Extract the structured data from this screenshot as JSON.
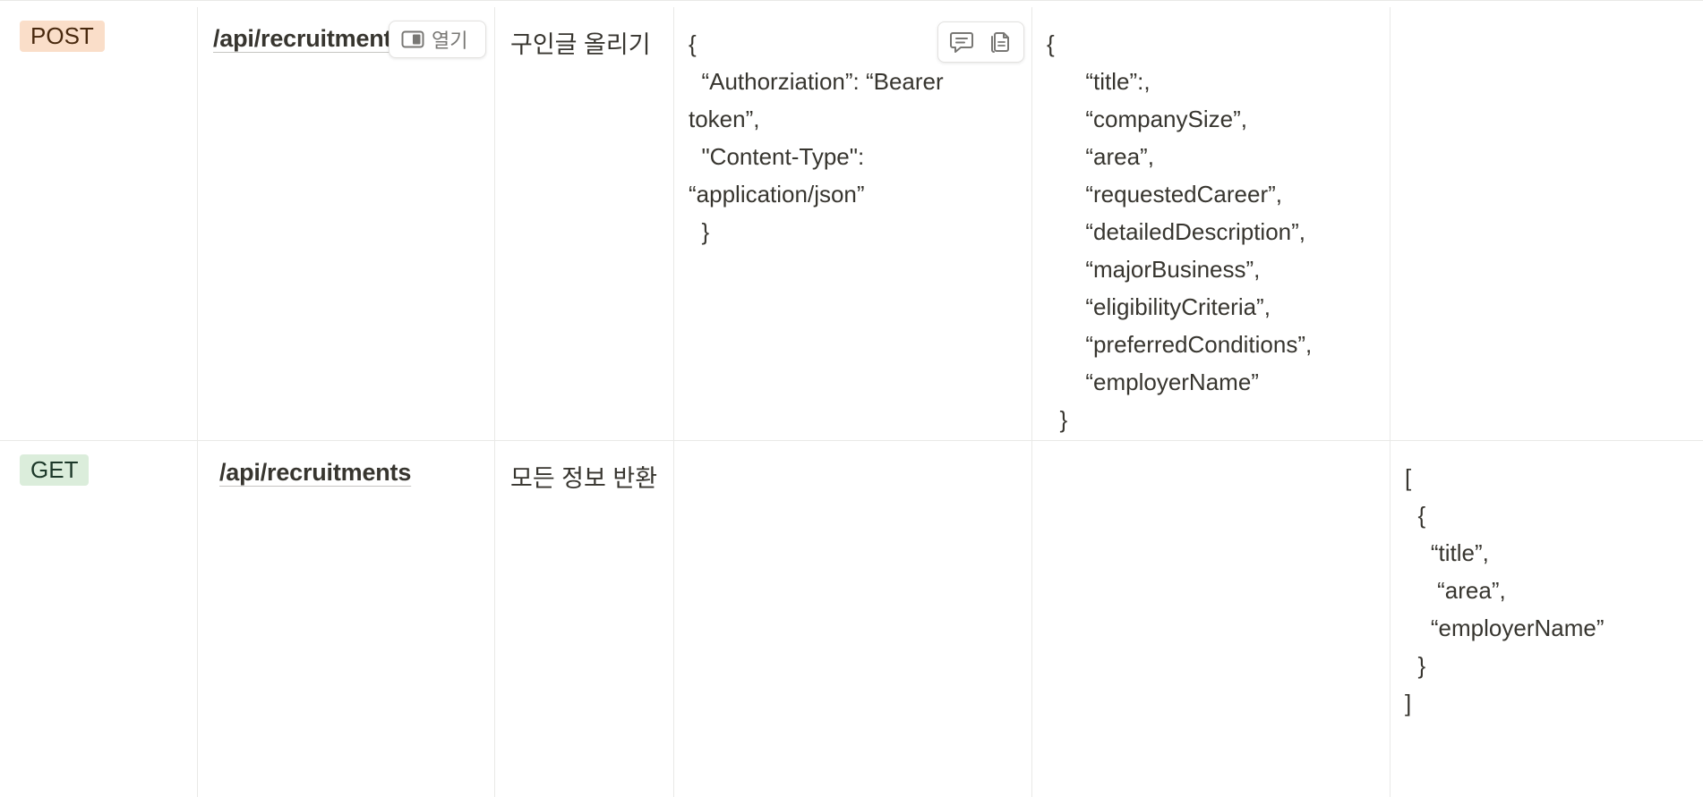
{
  "rows": [
    {
      "method": "POST",
      "url": "/api/recruitments",
      "open_label": "열기",
      "description": "구인글 올리기",
      "headers": "{\n  “Authorziation”: “Bearer\ntoken”,\n  \"Content-Type\":\n“application/json”\n  }",
      "body": "{\n      “title”:,\n      “companySize”,\n      “area”,\n      “requestedCareer”,\n      “detailedDescription”,\n      “majorBusiness”,\n      “eligibilityCriteria”,\n      “preferredConditions”,\n      “employerName”\n  }",
      "response": ""
    },
    {
      "method": "GET",
      "url": "/api/recruitments",
      "description": "모든 정보 반환",
      "headers": "",
      "body": "",
      "response": "[\n  {\n    “title”,\n     “area”,\n    “employerName”\n  }\n]"
    }
  ],
  "icons": {
    "open": "side-peek-icon",
    "comment": "comment-icon",
    "copy": "copy-icon"
  },
  "colors": {
    "post_tag_bg": "#fadec9",
    "get_tag_bg": "#dbeddb",
    "border": "#e9e9e7",
    "text": "#37352f"
  }
}
